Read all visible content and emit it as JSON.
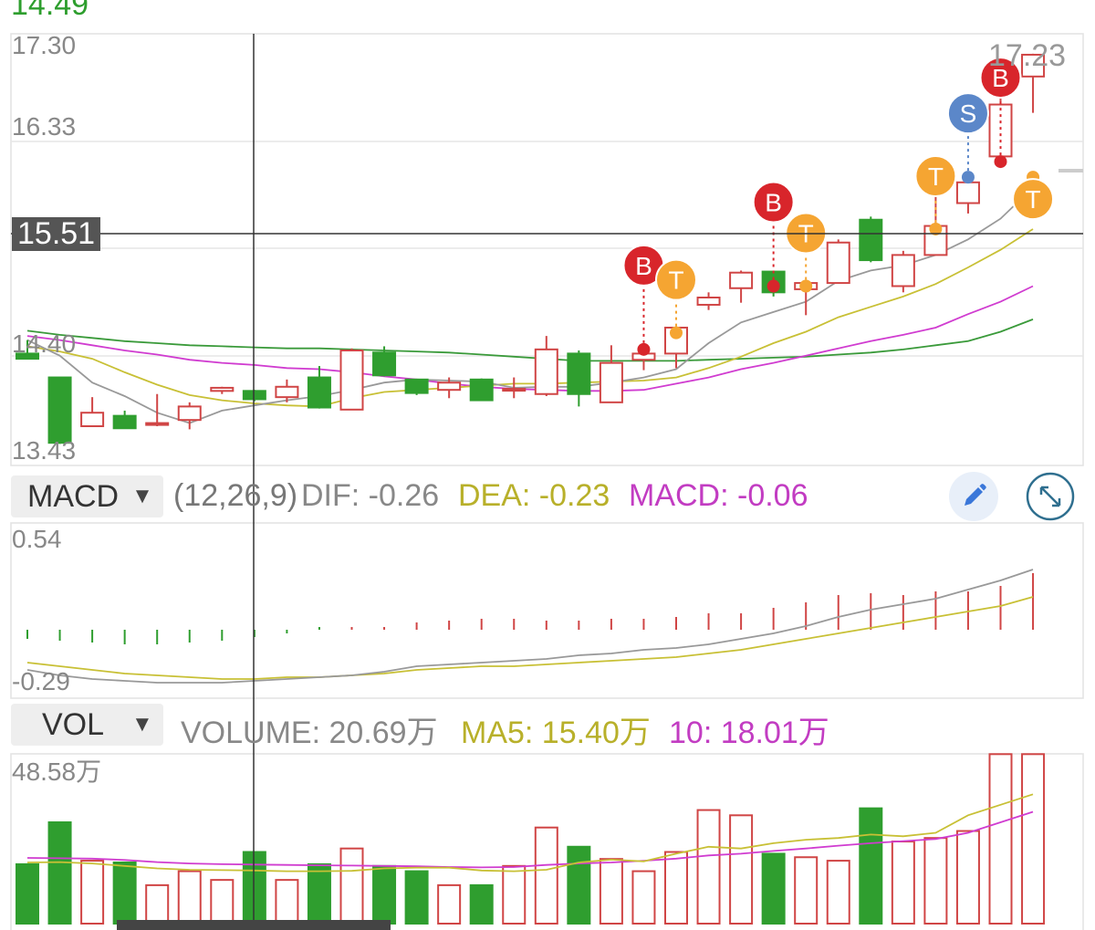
{
  "top_price": "14.49",
  "price_axis": {
    "max_label": "17.30",
    "label_2": "16.33",
    "label_3": "14.40",
    "min_label": "13.43",
    "high_marker": "17.23",
    "crosshair_price": "15.51"
  },
  "macd_header": {
    "indicator": "MACD",
    "params": "(12,26,9)",
    "dif": "DIF: -0.26",
    "dea": "DEA: -0.23",
    "macd": "MACD: -0.06"
  },
  "macd_axis": {
    "max_label": "0.54",
    "min_label": "-0.29"
  },
  "vol_header": {
    "indicator": "VOL",
    "volume": "VOLUME: 20.69万",
    "ma5": "MA5: 15.40万",
    "ma10": "10: 18.01万"
  },
  "vol_axis": {
    "max_label": "48.58万"
  },
  "colors": {
    "up": "#d04545",
    "down": "#2f9e2f",
    "ma_gray": "#999999",
    "ma_yellow": "#c8c035",
    "ma_magenta": "#d03cd0",
    "ma_green": "#3a9a3a",
    "buy": "#d8252b",
    "sell": "#5b87c9",
    "t_signal": "#f5a532",
    "top_price": "#2e9e2e"
  },
  "chart_data": [
    {
      "type": "candlestick",
      "ylim": [
        13.43,
        17.3
      ],
      "candles": [
        {
          "o": 14.35,
          "h": 14.48,
          "l": 14.3,
          "c": 14.3
        },
        {
          "o": 14.12,
          "h": 14.12,
          "l": 13.48,
          "c": 13.49
        },
        {
          "o": 13.65,
          "h": 13.93,
          "l": 13.65,
          "c": 13.78
        },
        {
          "o": 13.75,
          "h": 13.8,
          "l": 13.63,
          "c": 13.63
        },
        {
          "o": 13.68,
          "h": 13.96,
          "l": 13.65,
          "c": 13.68
        },
        {
          "o": 13.71,
          "h": 13.88,
          "l": 13.62,
          "c": 13.84
        },
        {
          "o": 13.99,
          "h": 14.03,
          "l": 13.96,
          "c": 14.02
        },
        {
          "o": 13.99,
          "h": 14.0,
          "l": 13.89,
          "c": 13.91
        },
        {
          "o": 13.93,
          "h": 14.1,
          "l": 13.88,
          "c": 14.03
        },
        {
          "o": 14.12,
          "h": 14.23,
          "l": 13.82,
          "c": 13.83
        },
        {
          "o": 13.81,
          "h": 14.4,
          "l": 13.81,
          "c": 14.38
        },
        {
          "o": 14.36,
          "h": 14.42,
          "l": 14.13,
          "c": 14.14
        },
        {
          "o": 14.1,
          "h": 14.1,
          "l": 13.95,
          "c": 13.97
        },
        {
          "o": 14.0,
          "h": 14.12,
          "l": 13.92,
          "c": 14.07
        },
        {
          "o": 14.1,
          "h": 14.11,
          "l": 13.9,
          "c": 13.9
        },
        {
          "o": 14.01,
          "h": 14.12,
          "l": 13.92,
          "c": 14.01
        },
        {
          "o": 13.96,
          "h": 14.52,
          "l": 13.94,
          "c": 14.39
        },
        {
          "o": 14.35,
          "h": 14.38,
          "l": 13.84,
          "c": 13.96
        },
        {
          "o": 13.88,
          "h": 14.43,
          "l": 13.88,
          "c": 14.26
        },
        {
          "o": 14.29,
          "h": 14.39,
          "l": 14.19,
          "c": 14.35
        },
        {
          "o": 14.35,
          "h": 14.61,
          "l": 14.21,
          "c": 14.6
        },
        {
          "o": 14.82,
          "h": 14.94,
          "l": 14.77,
          "c": 14.89
        },
        {
          "o": 14.98,
          "h": 15.15,
          "l": 14.84,
          "c": 15.13
        },
        {
          "o": 15.14,
          "h": 15.14,
          "l": 14.9,
          "c": 14.94
        },
        {
          "o": 14.97,
          "h": 15.03,
          "l": 14.72,
          "c": 15.03
        },
        {
          "o": 15.03,
          "h": 15.45,
          "l": 15.03,
          "c": 15.42
        },
        {
          "o": 15.64,
          "h": 15.67,
          "l": 15.23,
          "c": 15.25
        },
        {
          "o": 15.0,
          "h": 15.34,
          "l": 14.94,
          "c": 15.3
        },
        {
          "o": 15.3,
          "h": 15.91,
          "l": 15.3,
          "c": 15.58
        },
        {
          "o": 15.8,
          "h": 16.04,
          "l": 15.7,
          "c": 16.0
        },
        {
          "o": 16.25,
          "h": 17.06,
          "l": 16.23,
          "c": 16.75
        },
        {
          "o": 17.02,
          "h": 17.24,
          "l": 16.67,
          "c": 17.23
        }
      ],
      "ma_gray": [
        14.48,
        14.33,
        14.07,
        13.94,
        13.78,
        13.68,
        13.8,
        13.85,
        13.9,
        13.94,
        14.0,
        14.07,
        14.1,
        14.09,
        14.08,
        14.02,
        14.03,
        14.03,
        14.07,
        14.12,
        14.2,
        14.45,
        14.65,
        14.75,
        14.85,
        15.05,
        15.15,
        15.2,
        15.3,
        15.45,
        15.65,
        15.95
      ],
      "ma_yellow": [
        14.42,
        14.37,
        14.3,
        14.17,
        14.05,
        13.95,
        13.9,
        13.87,
        13.85,
        13.84,
        13.92,
        13.98,
        14.0,
        14.02,
        14.04,
        14.06,
        14.06,
        14.07,
        14.08,
        14.09,
        14.12,
        14.21,
        14.32,
        14.45,
        14.56,
        14.7,
        14.8,
        14.9,
        15.02,
        15.18,
        15.35,
        15.55
      ],
      "ma_magenta": [
        14.52,
        14.48,
        14.43,
        14.38,
        14.34,
        14.29,
        14.26,
        14.24,
        14.21,
        14.2,
        14.17,
        14.13,
        14.1,
        14.06,
        14.03,
        14.01,
        14.0,
        13.99,
        13.99,
        14.0,
        14.06,
        14.12,
        14.2,
        14.26,
        14.33,
        14.4,
        14.47,
        14.53,
        14.6,
        14.73,
        14.85,
        15.0
      ],
      "ma_green": [
        14.57,
        14.53,
        14.5,
        14.47,
        14.45,
        14.43,
        14.42,
        14.41,
        14.4,
        14.4,
        14.39,
        14.38,
        14.37,
        14.36,
        14.34,
        14.32,
        14.3,
        14.28,
        14.28,
        14.28,
        14.28,
        14.29,
        14.3,
        14.31,
        14.32,
        14.34,
        14.36,
        14.39,
        14.43,
        14.47,
        14.56,
        14.68
      ],
      "signals": [
        {
          "i": 19,
          "type": "B",
          "price": 14.39
        },
        {
          "i": 20,
          "type": "T",
          "price": 14.55
        },
        {
          "i": 23,
          "type": "B",
          "price": 15.0
        },
        {
          "i": 24,
          "type": "T",
          "price": 15.0
        },
        {
          "i": 28,
          "type": "T",
          "price": 15.55
        },
        {
          "i": 29,
          "type": "S",
          "price": 16.05
        },
        {
          "i": 30,
          "type": "B",
          "price": 16.2
        },
        {
          "i": 31,
          "type": "T",
          "price": 16.05
        }
      ]
    },
    {
      "type": "bar",
      "name": "MACD",
      "ylim": [
        -0.29,
        0.54
      ],
      "macd": [
        -0.05,
        -0.06,
        -0.07,
        -0.08,
        -0.08,
        -0.07,
        -0.06,
        -0.04,
        -0.02,
        -0.01,
        0.0,
        0.01,
        0.04,
        0.05,
        0.06,
        0.06,
        0.05,
        0.05,
        0.06,
        0.06,
        0.07,
        0.09,
        0.09,
        0.12,
        0.15,
        0.19,
        0.2,
        0.19,
        0.21,
        0.21,
        0.24,
        0.31
      ],
      "dif": [
        -0.22,
        -0.25,
        -0.27,
        -0.28,
        -0.29,
        -0.29,
        -0.29,
        -0.28,
        -0.27,
        -0.26,
        -0.25,
        -0.23,
        -0.2,
        -0.19,
        -0.18,
        -0.17,
        -0.16,
        -0.14,
        -0.13,
        -0.11,
        -0.1,
        -0.08,
        -0.05,
        -0.02,
        0.02,
        0.07,
        0.11,
        0.14,
        0.17,
        0.22,
        0.27,
        0.33
      ],
      "dea": [
        -0.18,
        -0.2,
        -0.22,
        -0.24,
        -0.25,
        -0.26,
        -0.27,
        -0.27,
        -0.26,
        -0.26,
        -0.25,
        -0.24,
        -0.22,
        -0.21,
        -0.2,
        -0.2,
        -0.19,
        -0.18,
        -0.17,
        -0.16,
        -0.15,
        -0.13,
        -0.11,
        -0.08,
        -0.05,
        -0.02,
        0.01,
        0.04,
        0.07,
        0.1,
        0.13,
        0.18
      ]
    },
    {
      "type": "bar",
      "name": "VOL",
      "ylim": [
        0,
        48.58
      ],
      "volumes": [
        17.0,
        29.0,
        18.0,
        17.5,
        11.0,
        15.0,
        12.5,
        20.5,
        12.5,
        17.0,
        21.5,
        16.5,
        15.0,
        11.0,
        11.0,
        16.5,
        27.5,
        22.0,
        18.5,
        15.0,
        20.5,
        32.5,
        31.0,
        20.0,
        19.0,
        18.0,
        33.0,
        23.5,
        24.5,
        26.5,
        48.5,
        48.5
      ],
      "ma5": [
        17.5,
        17.6,
        17.2,
        16.5,
        15.8,
        15.4,
        15.3,
        15.2,
        15.0,
        15.0,
        15.1,
        15.8,
        16.0,
        16.0,
        15.2,
        15.0,
        15.4,
        17.5,
        18.3,
        17.8,
        20.0,
        22.0,
        21.5,
        23.0,
        24.0,
        24.5,
        25.5,
        25.0,
        26.0,
        31.0,
        34.0,
        37.0
      ],
      "ma10": [
        18.8,
        18.7,
        18.6,
        18.2,
        17.6,
        17.2,
        17.0,
        16.9,
        16.8,
        16.7,
        16.6,
        16.5,
        16.4,
        16.2,
        16.1,
        16.2,
        16.8,
        17.2,
        17.5,
        18.0,
        18.6,
        19.5,
        20.0,
        20.8,
        21.5,
        22.3,
        23.0,
        23.6,
        24.2,
        26.0,
        29.0,
        32.0
      ]
    }
  ]
}
